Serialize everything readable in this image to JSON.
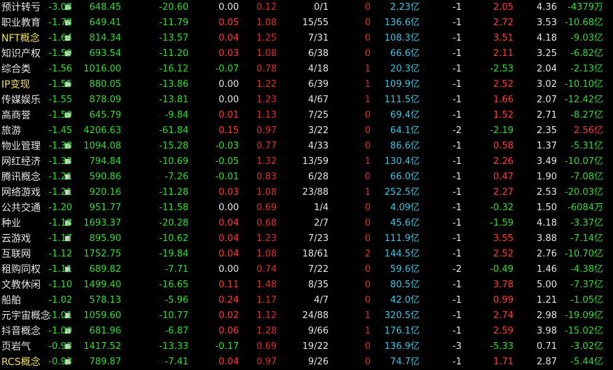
{
  "rows": [
    {
      "name": "预计转亏",
      "marker": "■",
      "chg": "-3.08",
      "price": "648.45",
      "diff": "-20.60",
      "speed": "0.00",
      "turnover": "0.12",
      "updown": "0/1",
      "lead": "0",
      "amount": "2.23亿",
      "rank": "-1",
      "amp": "2.05",
      "vol_ratio": "4.36",
      "net_flow": "-4379万"
    },
    {
      "name": "职业教育",
      "marker": "■",
      "chg": "-1.78",
      "price": "649.41",
      "diff": "-11.79",
      "speed": "0.05",
      "turnover": "1.08",
      "updown": "15/55",
      "lead": "0",
      "amount": "136.6亿",
      "rank": "-1",
      "amp": "2.72",
      "vol_ratio": "3.53",
      "net_flow": "-10.68亿"
    },
    {
      "name": "NFT概念",
      "marker": "■",
      "chg": "-1.64",
      "price": "814.34",
      "diff": "-13.57",
      "speed": "0.04",
      "turnover": "1.25",
      "updown": "7/31",
      "lead": "0",
      "amount": "108.3亿",
      "rank": "-1",
      "amp": "3.51",
      "vol_ratio": "4.18",
      "net_flow": "-9.03亿"
    },
    {
      "name": "知识产权",
      "marker": "■",
      "chg": "-1.59",
      "price": "693.54",
      "diff": "-11.20",
      "speed": "0.03",
      "turnover": "1.08",
      "updown": "6/38",
      "lead": "0",
      "amount": "66.6亿",
      "rank": "-1",
      "amp": "2.11",
      "vol_ratio": "3.25",
      "net_flow": "-6.82亿"
    },
    {
      "name": "综合类",
      "marker": "",
      "chg": "-1.56",
      "price": "1016.00",
      "diff": "-16.12",
      "speed": "-0.07",
      "turnover": "0.78",
      "updown": "4/18",
      "lead": "1",
      "amount": "20.3亿",
      "rank": "-1",
      "amp": "-2.53",
      "vol_ratio": "2.04",
      "net_flow": "-2.13亿"
    },
    {
      "name": "IP变现",
      "marker": "■",
      "chg": "-1.55",
      "price": "880.05",
      "diff": "-13.86",
      "speed": "0.00",
      "turnover": "1.22",
      "updown": "6/39",
      "lead": "1",
      "amount": "109.9亿",
      "rank": "-1",
      "amp": "2.52",
      "vol_ratio": "3.02",
      "net_flow": "-10.10亿"
    },
    {
      "name": "传媒娱乐",
      "marker": "",
      "chg": "-1.55",
      "price": "878.09",
      "diff": "-13.81",
      "speed": "0.00",
      "turnover": "1.23",
      "updown": "4/67",
      "lead": "1",
      "amount": "111.5亿",
      "rank": "-1",
      "amp": "1.66",
      "vol_ratio": "2.07",
      "net_flow": "-12.42亿"
    },
    {
      "name": "高商誉",
      "marker": "■",
      "chg": "-1.50",
      "price": "645.79",
      "diff": "-9.84",
      "speed": "0.01",
      "turnover": "1.13",
      "updown": "7/25",
      "lead": "0",
      "amount": "69.4亿",
      "rank": "-1",
      "amp": "1.52",
      "vol_ratio": "2.71",
      "net_flow": "-8.27亿"
    },
    {
      "name": "旅游",
      "marker": "",
      "chg": "-1.45",
      "price": "4206.63",
      "diff": "-61.84",
      "speed": "0.15",
      "turnover": "0.97",
      "updown": "3/22",
      "lead": "0",
      "amount": "64.1亿",
      "rank": "-2",
      "amp": "-2.19",
      "vol_ratio": "2.35",
      "net_flow": "2.56亿"
    },
    {
      "name": "物业管理",
      "marker": "■",
      "chg": "-1.38",
      "price": "1094.08",
      "diff": "-15.28",
      "speed": "-0.03",
      "turnover": "0.77",
      "updown": "4/33",
      "lead": "0",
      "amount": "86.6亿",
      "rank": "-1",
      "amp": "0.58",
      "vol_ratio": "1.37",
      "net_flow": "-5.31亿"
    },
    {
      "name": "网红经济",
      "marker": "■",
      "chg": "-1.33",
      "price": "794.84",
      "diff": "-10.69",
      "speed": "-0.05",
      "turnover": "1.32",
      "updown": "13/59",
      "lead": "1",
      "amount": "130.4亿",
      "rank": "-1",
      "amp": "2.26",
      "vol_ratio": "3.49",
      "net_flow": "-10.07亿"
    },
    {
      "name": "腾讯概念",
      "marker": "■",
      "chg": "-1.21",
      "price": "590.86",
      "diff": "-7.26",
      "speed": "-0.01",
      "turnover": "0.83",
      "updown": "6/28",
      "lead": "0",
      "amount": "66.0亿",
      "rank": "-1",
      "amp": "0.47",
      "vol_ratio": "1.90",
      "net_flow": "-7.08亿"
    },
    {
      "name": "网络游戏",
      "marker": "■",
      "chg": "-1.21",
      "price": "920.16",
      "diff": "-11.28",
      "speed": "0.03",
      "turnover": "1.08",
      "updown": "23/88",
      "lead": "1",
      "amount": "252.5亿",
      "rank": "-1",
      "amp": "2.27",
      "vol_ratio": "2.53",
      "net_flow": "-20.03亿"
    },
    {
      "name": "公共交通",
      "marker": "",
      "chg": "-1.20",
      "price": "951.77",
      "diff": "-11.58",
      "speed": "0.00",
      "turnover": "0.69",
      "updown": "1/4",
      "lead": "0",
      "amount": "4.09亿",
      "rank": "-1",
      "amp": "-0.32",
      "vol_ratio": "1.50",
      "net_flow": "-6084万"
    },
    {
      "name": "种业",
      "marker": "■",
      "chg": "-1.18",
      "price": "1693.37",
      "diff": "-20.28",
      "speed": "0.04",
      "turnover": "0.68",
      "updown": "2/7",
      "lead": "0",
      "amount": "45.6亿",
      "rank": "-1",
      "amp": "-1.59",
      "vol_ratio": "4.18",
      "net_flow": "-3.37亿"
    },
    {
      "name": "云游戏",
      "marker": "■",
      "chg": "-1.17",
      "price": "895.90",
      "diff": "-10.62",
      "speed": "0.04",
      "turnover": "1.23",
      "updown": "7/23",
      "lead": "0",
      "amount": "111.9亿",
      "rank": "-1",
      "amp": "3.55",
      "vol_ratio": "3.88",
      "net_flow": "-7.14亿"
    },
    {
      "name": "互联网",
      "marker": "",
      "chg": "-1.12",
      "price": "1752.75",
      "diff": "-19.84",
      "speed": "0.04",
      "turnover": "1.08",
      "updown": "18/61",
      "lead": "2",
      "amount": "144.5亿",
      "rank": "-1",
      "amp": "2.52",
      "vol_ratio": "2.76",
      "net_flow": "-10.70亿"
    },
    {
      "name": "租购同权",
      "marker": "■",
      "chg": "-1.11",
      "price": "689.82",
      "diff": "-7.71",
      "speed": "0.00",
      "turnover": "0.74",
      "updown": "7/22",
      "lead": "0",
      "amount": "59.6亿",
      "rank": "-2",
      "amp": "-0.49",
      "vol_ratio": "1.46",
      "net_flow": "-4.38亿"
    },
    {
      "name": "文教休闲",
      "marker": "",
      "chg": "-1.10",
      "price": "1499.40",
      "diff": "-16.65",
      "speed": "0.11",
      "turnover": "1.48",
      "updown": "8/35",
      "lead": "0",
      "amount": "80.5亿",
      "rank": "-1",
      "amp": "3.78",
      "vol_ratio": "5.00",
      "net_flow": "-7.37亿"
    },
    {
      "name": "船舶",
      "marker": "",
      "chg": "-1.02",
      "price": "578.13",
      "diff": "-5.96",
      "speed": "0.24",
      "turnover": "1.17",
      "updown": "4/7",
      "lead": "0",
      "amount": "42.0亿",
      "rank": "-1",
      "amp": "0.99",
      "vol_ratio": "1.21",
      "net_flow": "-1.05亿"
    },
    {
      "name": "元宇宙概念",
      "marker": "■",
      "chg": "-1.01",
      "price": "1059.60",
      "diff": "-10.77",
      "speed": "0.02",
      "turnover": "1.12",
      "updown": "24/88",
      "lead": "1",
      "amount": "320.5亿",
      "rank": "-1",
      "amp": "2.74",
      "vol_ratio": "2.98",
      "net_flow": "-19.09亿"
    },
    {
      "name": "抖音概念",
      "marker": "■",
      "chg": "-1.00",
      "price": "681.96",
      "diff": "-6.87",
      "speed": "0.06",
      "turnover": "1.28",
      "updown": "9/66",
      "lead": "1",
      "amount": "176.1亿",
      "rank": "-1",
      "amp": "2.59",
      "vol_ratio": "3.98",
      "net_flow": "-15.02亿"
    },
    {
      "name": "页岩气",
      "marker": "■",
      "chg": "-0.93",
      "price": "1417.52",
      "diff": "-13.33",
      "speed": "-0.17",
      "turnover": "0.69",
      "updown": "19/22",
      "lead": "0",
      "amount": "136.9亿",
      "rank": "-3",
      "amp": "-5.33",
      "vol_ratio": "0.71",
      "net_flow": "-3.02亿"
    },
    {
      "name": "RCS概念",
      "marker": "■",
      "chg": "-0.93",
      "price": "789.87",
      "diff": "-7.41",
      "speed": "0.04",
      "turnover": "0.97",
      "updown": "9/26",
      "lead": "0",
      "amount": "74.7亿",
      "rank": "-1",
      "amp": "1.71",
      "vol_ratio": "2.87",
      "net_flow": "-5.44亿"
    }
  ],
  "colors": {
    "up": "#ff3b3b",
    "down": "#33dd33",
    "neutral": "#e6e6e6",
    "amount": "#38c8e8",
    "background": "#000000"
  }
}
